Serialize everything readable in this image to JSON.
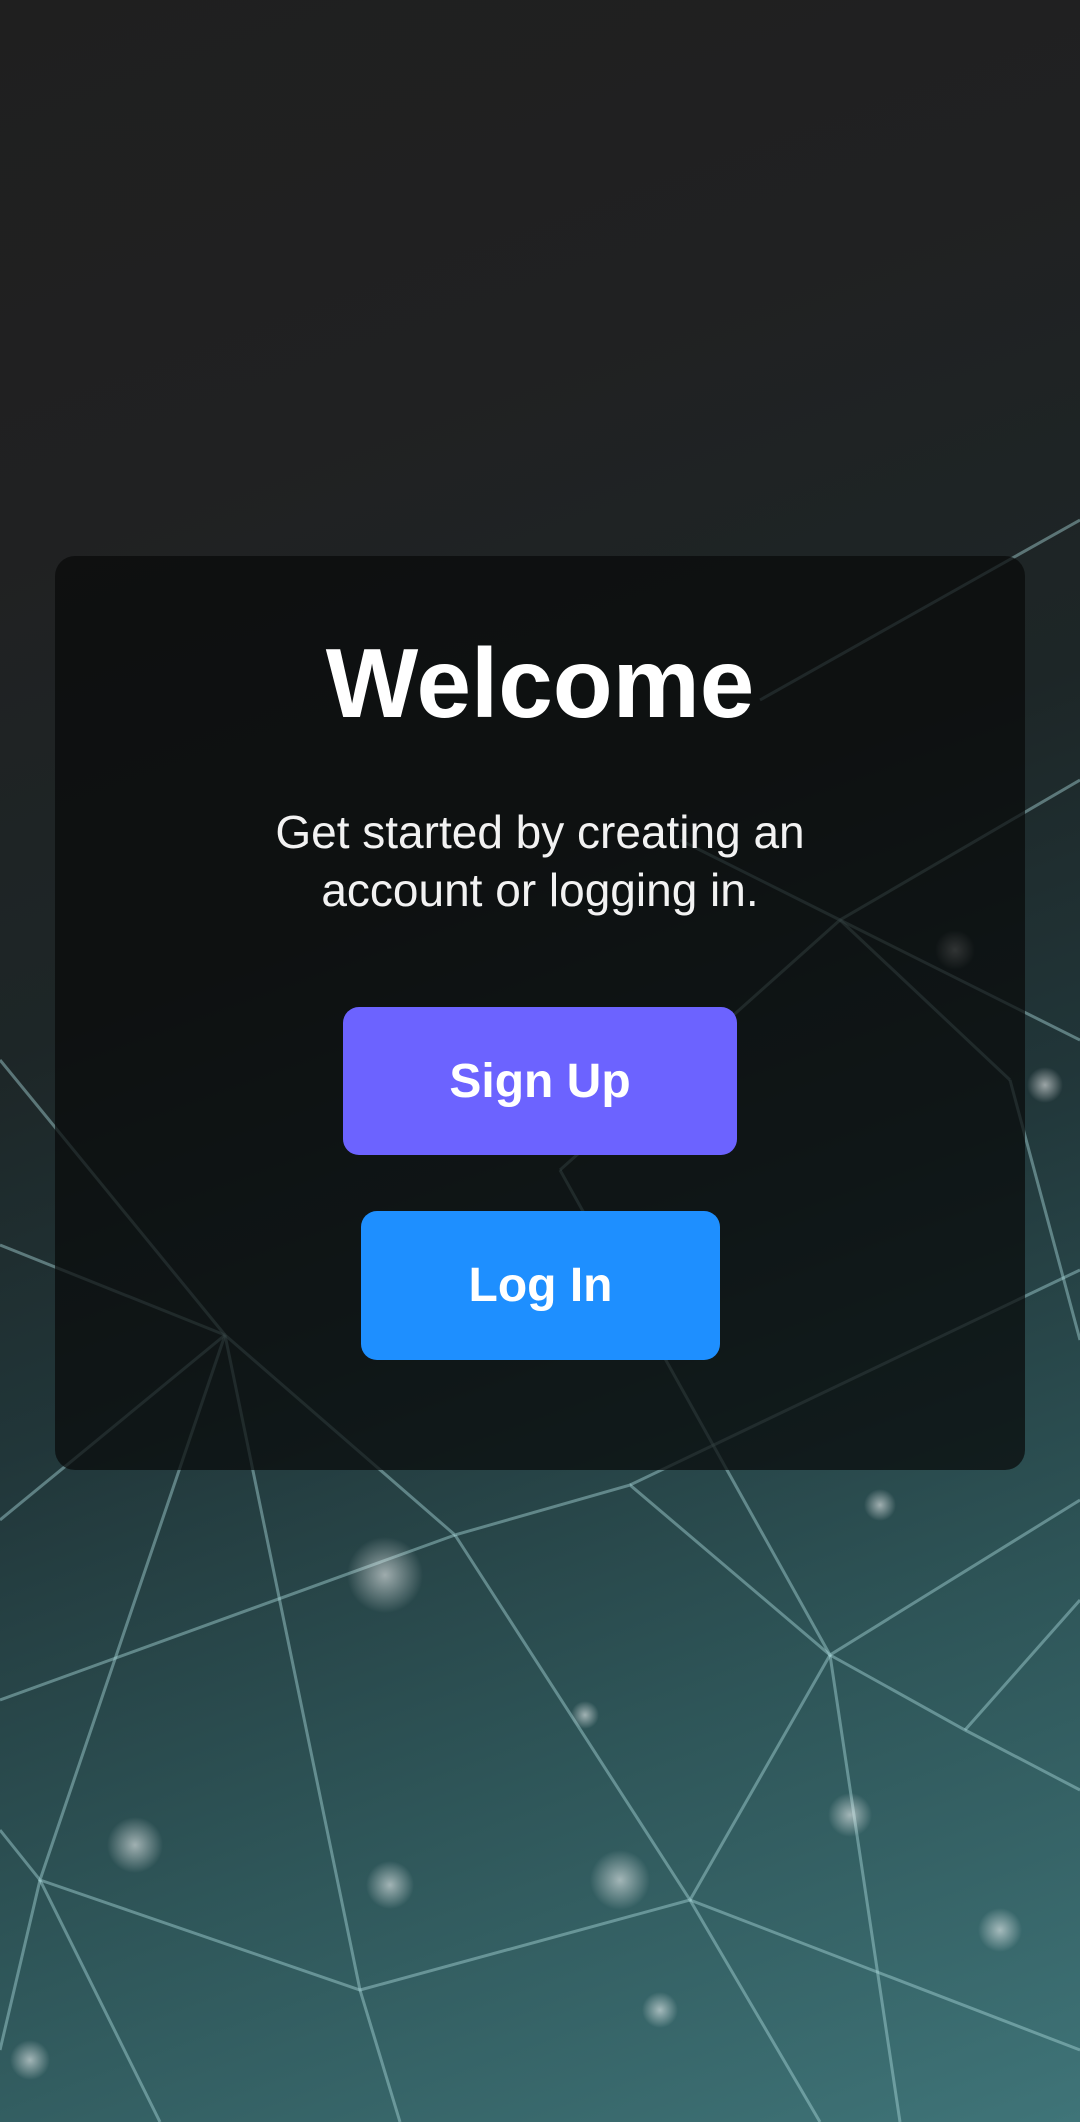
{
  "welcome": {
    "title": "Welcome",
    "subtitle": "Get started by creating an account or logging in.",
    "buttons": {
      "signup_label": "Sign Up",
      "login_label": "Log In"
    }
  },
  "colors": {
    "signup_button": "#6c63ff",
    "login_button": "#1e8fff",
    "card": "#080a0a",
    "text": "#ffffff"
  }
}
